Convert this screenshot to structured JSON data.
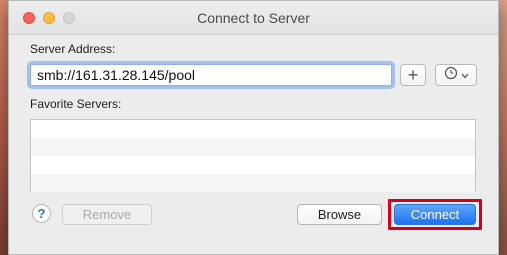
{
  "window": {
    "title": "Connect to Server"
  },
  "server_address": {
    "label": "Server Address:",
    "value": "smb://161.31.28.145/pool"
  },
  "favorites": {
    "label": "Favorite Servers:",
    "items": []
  },
  "buttons": {
    "add_symbol": "+",
    "help_symbol": "?",
    "remove_label": "Remove",
    "browse_label": "Browse",
    "connect_label": "Connect"
  },
  "colors": {
    "accent": "#1c74f2",
    "highlight_box": "#d0021b",
    "close": "#fc615d",
    "minimize": "#fdbc40"
  },
  "icons": {
    "action": "recent-servers-clock-icon"
  }
}
